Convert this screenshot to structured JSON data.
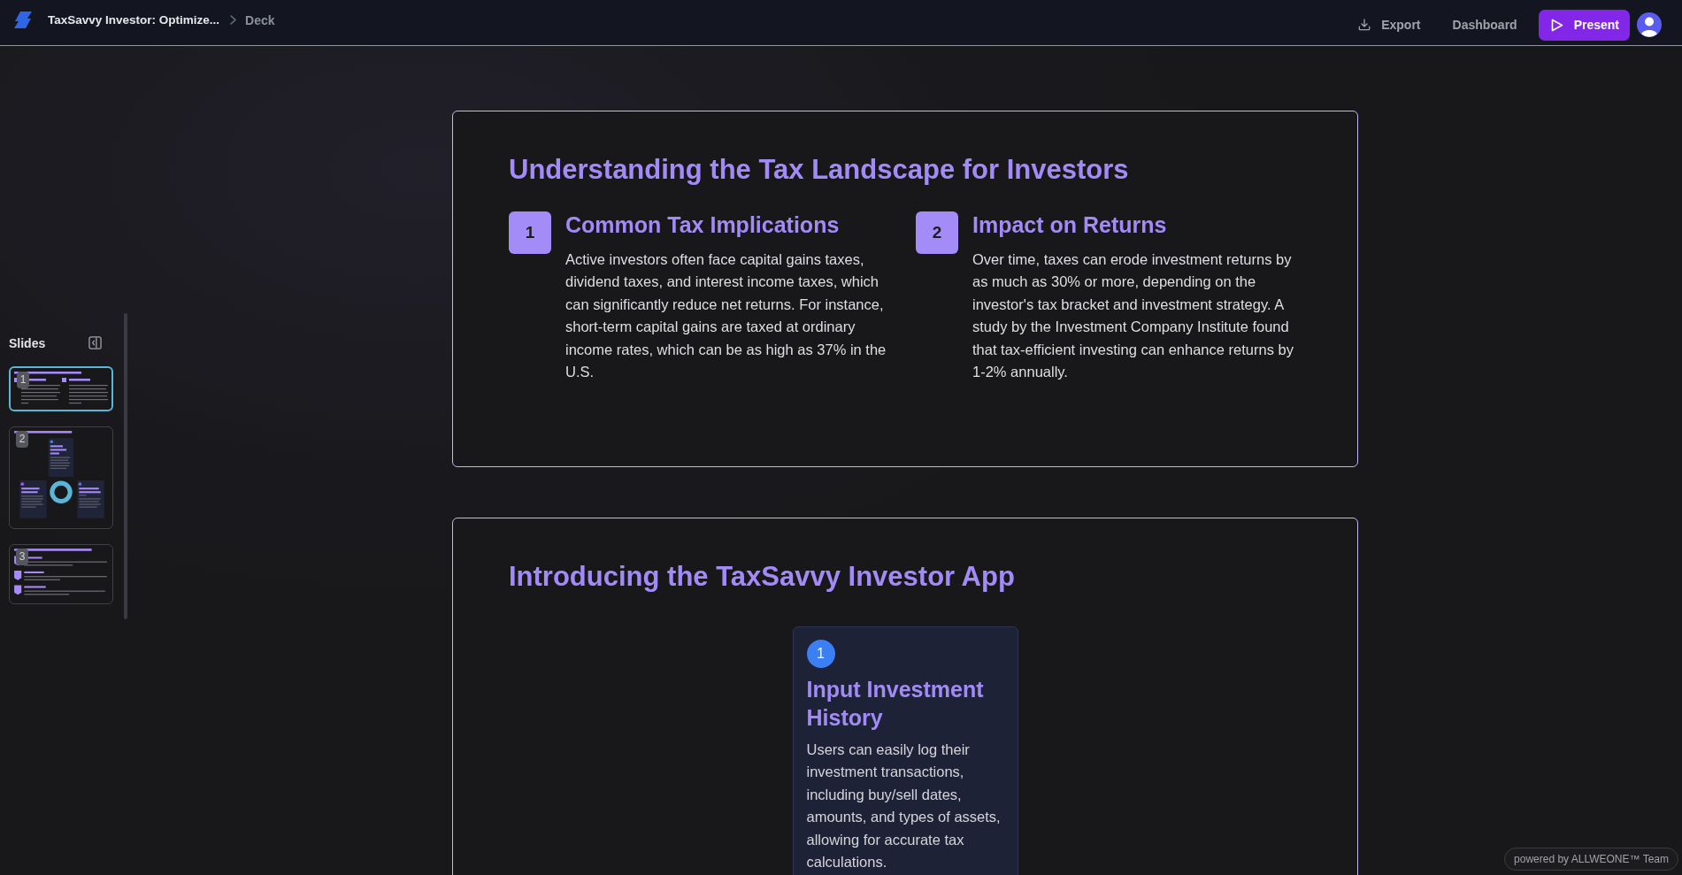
{
  "header": {
    "title": "TaxSavvy Investor: Optimize...",
    "breadcrumb": "Deck",
    "actions": [
      {
        "label": "Export",
        "kind": "export"
      },
      {
        "label": "Dashboard",
        "kind": "link"
      },
      {
        "label": "Present",
        "kind": "primary"
      }
    ]
  },
  "sidebar": {
    "title": "Slides",
    "slides": [
      {
        "number": "1",
        "kind": "columns",
        "selected": true
      },
      {
        "number": "2",
        "kind": "cards",
        "selected": false
      },
      {
        "number": "3",
        "kind": "list",
        "selected": false
      }
    ]
  },
  "slides": [
    {
      "kind": "numbered_columns",
      "title": "Understanding the Tax Landscape for Investors",
      "items": [
        {
          "number": "1",
          "heading": "Common Tax Implications",
          "text": "Active investors often face capital gains taxes, dividend taxes, and interest income taxes, which can significantly reduce net returns. For instance, short-term capital gains are taxed at ordinary income rates, which can be as high as 37% in the U.S."
        },
        {
          "number": "2",
          "heading": "Impact on Returns",
          "text": "Over time, taxes can erode investment returns by as much as 30% or more, depending on the investor's tax bracket and investment strategy. A study by the Investment Company Institute found that tax-efficient investing can enhance returns by 1-2% annually."
        }
      ]
    },
    {
      "kind": "feature_cards",
      "title": "Introducing the TaxSavvy Investor App",
      "items": [
        {
          "number": "1",
          "heading": "Input Investment History",
          "text": "Users can easily log their investment transactions, including buy/sell dates, amounts, and types of assets, allowing for accurate tax calculations."
        }
      ]
    }
  ],
  "credit": "powered by ALLWEONE™ Team"
}
